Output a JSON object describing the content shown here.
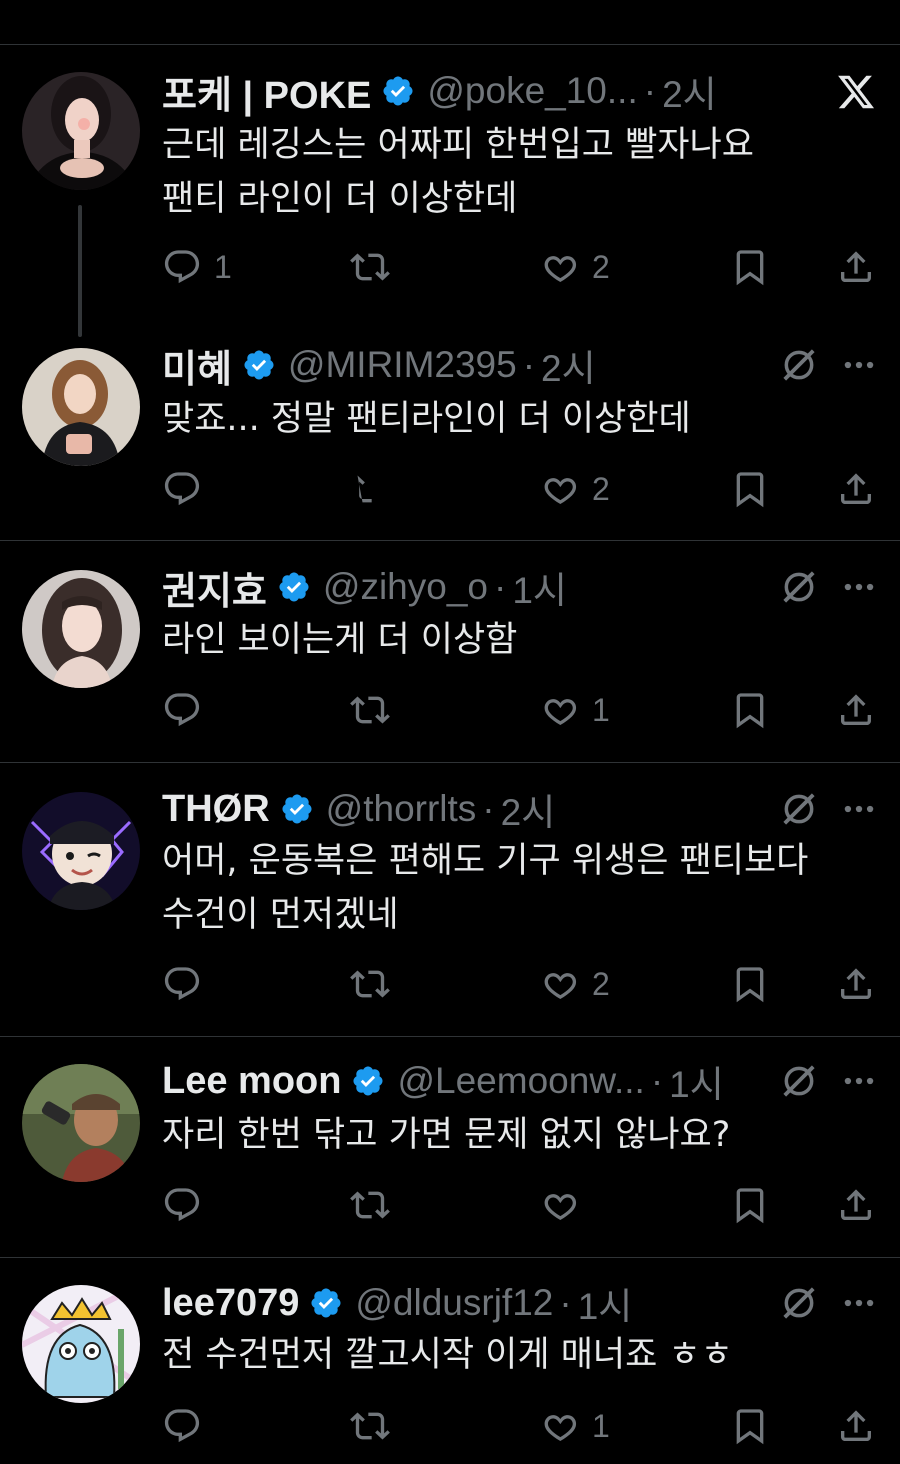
{
  "colors": {
    "background": "#000000",
    "text": "#e7e9ea",
    "muted": "#71767b",
    "verified": "#1d9bf0",
    "divider": "#2f3336"
  },
  "icons": {
    "reply": "reply-icon",
    "retweet": "retweet-icon",
    "like": "heart-icon",
    "bookmark": "bookmark-icon",
    "share": "share-icon",
    "more": "more-icon",
    "grok": "grok-icon",
    "x": "x-logo-icon",
    "verified": "verified-badge-icon"
  },
  "tweets": [
    {
      "name": "포케 | POKE",
      "handle": "@poke_10...",
      "dot": "·",
      "time": "2시",
      "text": "근데 레깅스는 어짜피 한번입고 빨자나요\n팬티 라인이 더 이상한데",
      "replies": "1",
      "likes": "2"
    },
    {
      "name": "미혜",
      "handle": "@MIRIM2395",
      "dot": "·",
      "time": "2시",
      "text": "맞죠... 정말 팬티라인이 더 이상한데",
      "replies": "",
      "likes": "2"
    },
    {
      "name": "권지효",
      "handle": "@zihyo_o",
      "dot": "·",
      "time": "1시",
      "text": "라인 보이는게 더 이상함",
      "replies": "",
      "likes": "1"
    },
    {
      "name": "THØR",
      "handle": "@thorrlts",
      "dot": "·",
      "time": "2시",
      "text": "어머, 운동복은 편해도 기구 위생은 팬티보다\n수건이 먼저겠네",
      "replies": "",
      "likes": "2"
    },
    {
      "name": "Lee moon",
      "handle": "@Leemoonw...",
      "dot": "·",
      "time": "1시",
      "text": "자리 한번 닦고 가면 문제 없지 않나요?",
      "replies": "",
      "likes": ""
    },
    {
      "name": "lee7079",
      "handle": "@dldusrjf12",
      "dot": "·",
      "time": "1시",
      "text": "전 수건먼저 깔고시작 이게 매너죠 ㅎㅎ",
      "replies": "",
      "likes": "1"
    }
  ]
}
